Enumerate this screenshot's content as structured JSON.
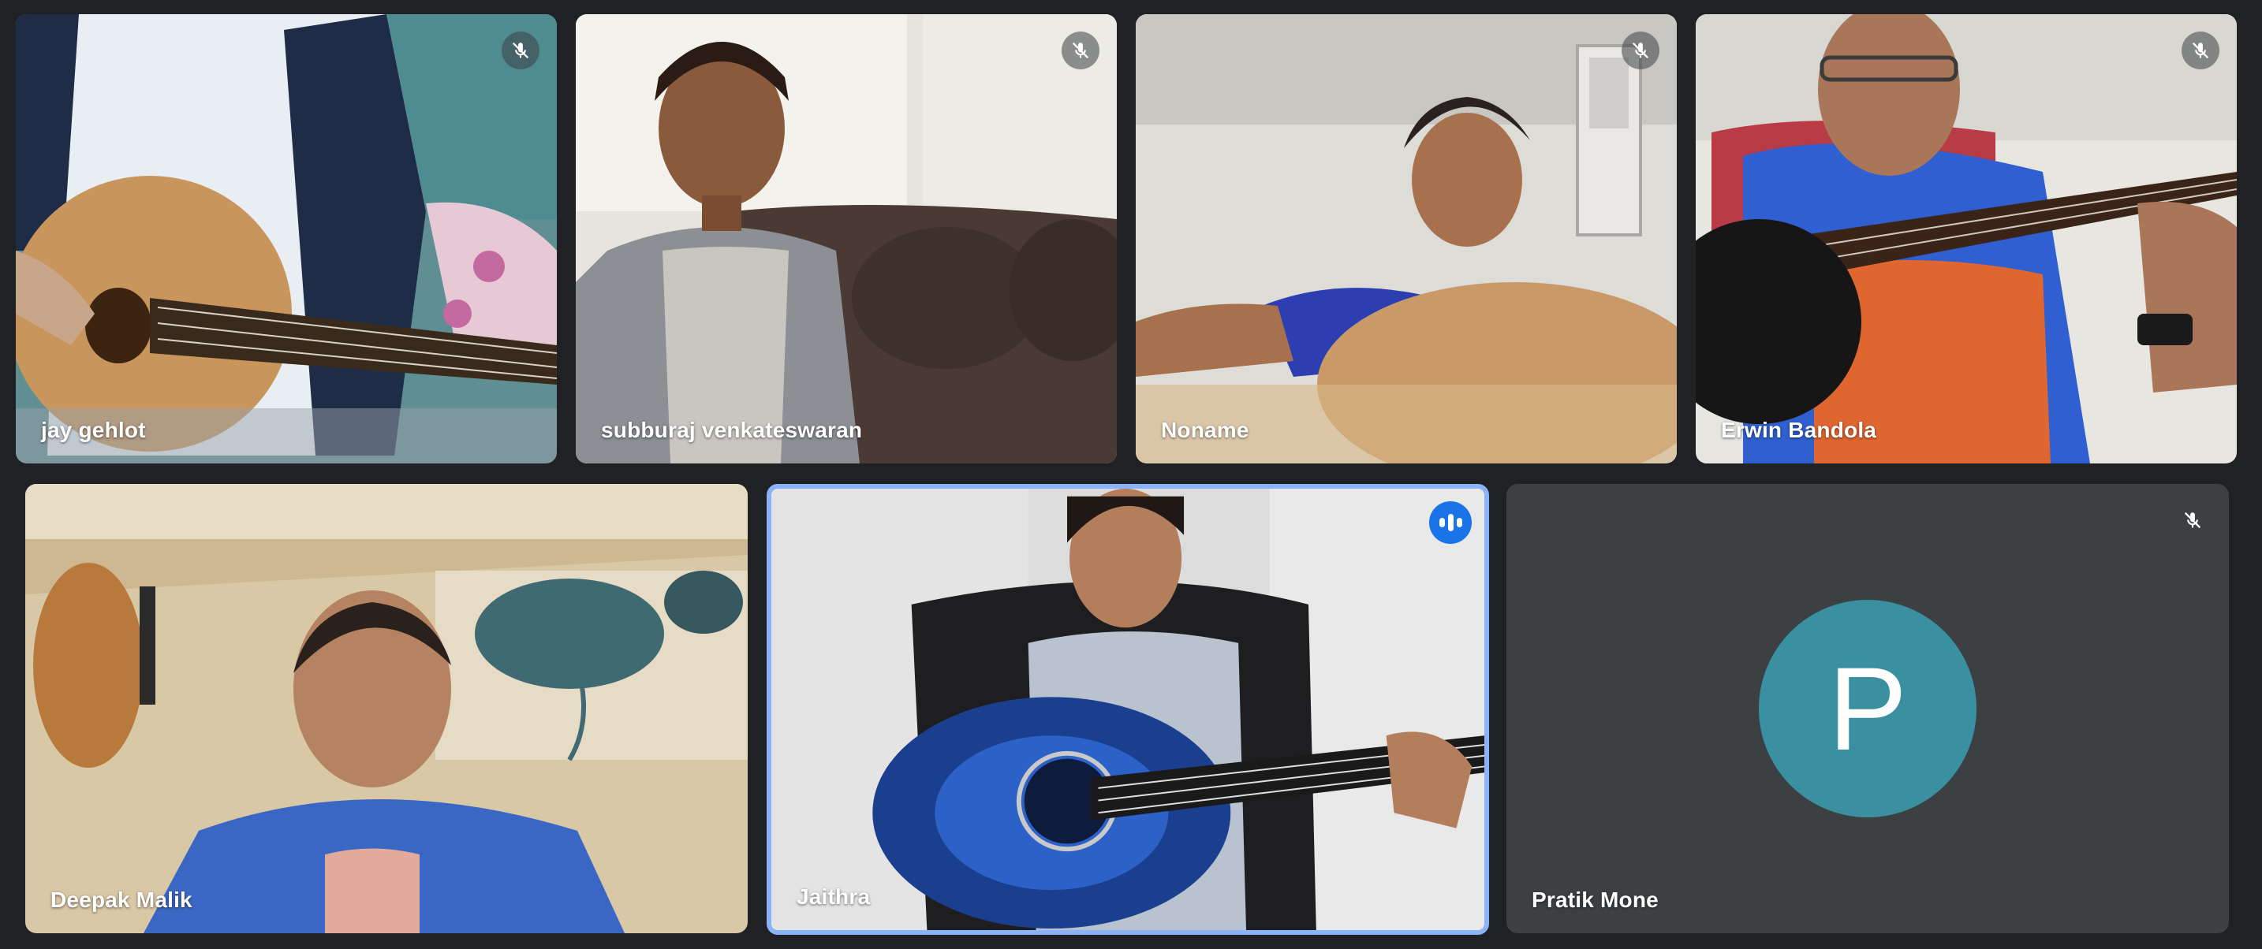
{
  "meeting": {
    "participants": [
      {
        "name": "jay gehlot",
        "muted": true
      },
      {
        "name": "subburaj venkateswaran",
        "muted": true
      },
      {
        "name": "Noname",
        "muted": true
      },
      {
        "name": "Erwin Bandola",
        "muted": true
      },
      {
        "name": "Deepak Malik",
        "muted": false
      },
      {
        "name": "Jaithra",
        "speaking": true
      },
      {
        "name": "Pratik Mone",
        "muted": true,
        "avatar_letter": "P",
        "avatar_color": "#3a8fa0"
      }
    ]
  },
  "colors": {
    "background": "#202124",
    "tile_empty": "#3c4043",
    "active_border": "#8ab4f8",
    "speaking_badge": "#1a73e8"
  },
  "icons": {
    "muted": "mic-off-icon",
    "speaking": "audio-level-icon"
  }
}
